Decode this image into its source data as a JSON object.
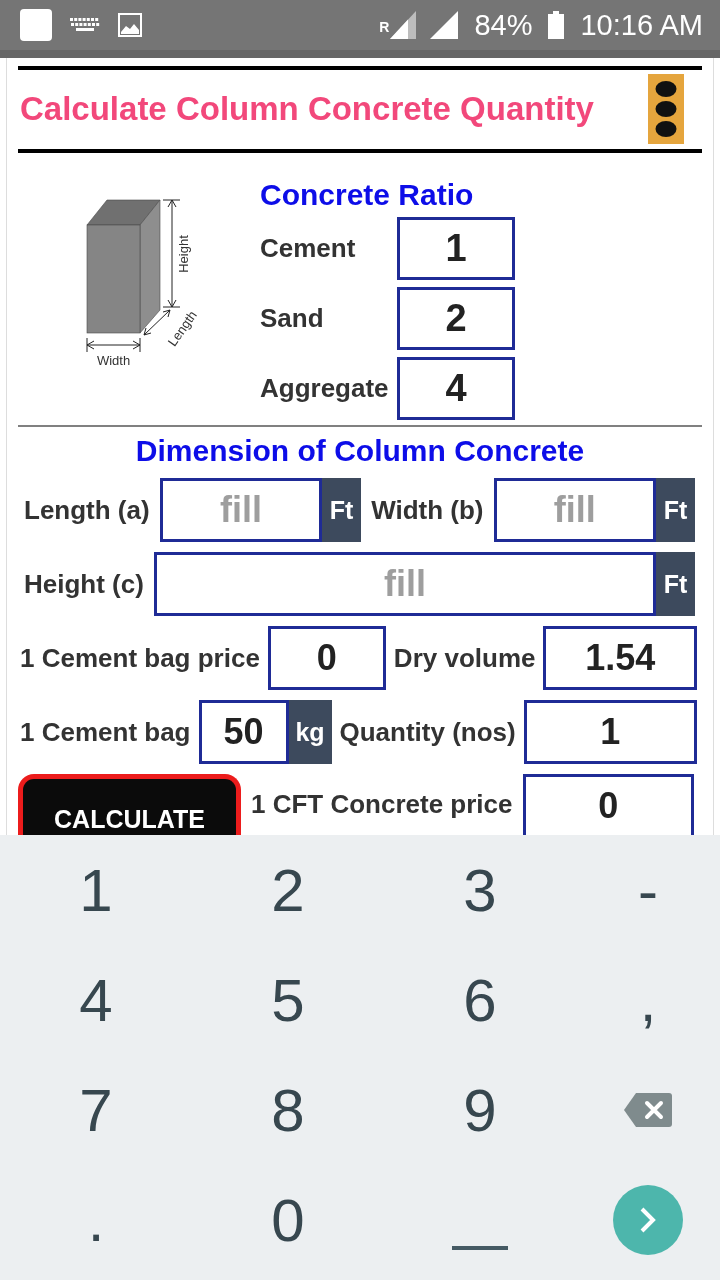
{
  "status_bar": {
    "roaming": "R",
    "battery": "84%",
    "time": "10:16 AM"
  },
  "header": {
    "title": "Calculate Column Concrete Quantity"
  },
  "figure": {
    "height_label": "Height",
    "length_label": "Length",
    "width_label": "Width"
  },
  "ratio": {
    "heading": "Concrete Ratio",
    "rows": [
      {
        "label": "Cement",
        "value": "1"
      },
      {
        "label": "Sand",
        "value": "2"
      },
      {
        "label": "Aggregate",
        "value": "4"
      }
    ]
  },
  "dimensions": {
    "heading": "Dimension of Column Concrete",
    "rows": [
      {
        "fields": [
          {
            "label": "Length (a)",
            "placeholder": "fill",
            "unit": "Ft"
          },
          {
            "label": "Width (b)",
            "placeholder": "fill",
            "unit": "Ft"
          }
        ]
      },
      {
        "fields": [
          {
            "label": "Height (c)",
            "placeholder": "fill",
            "unit": "Ft"
          }
        ]
      }
    ]
  },
  "results": {
    "rows": [
      {
        "items": [
          {
            "kind": "field",
            "label": "1 Cement bag price",
            "value": "0"
          },
          {
            "kind": "field",
            "label": "Dry volume",
            "value": "1.54"
          }
        ]
      },
      {
        "items": [
          {
            "kind": "field",
            "label": "1 Cement bag",
            "value": "50",
            "unit": "kg"
          },
          {
            "kind": "field",
            "label": "Quantity (nos)",
            "value": "1"
          }
        ]
      },
      {
        "items": [
          {
            "kind": "button",
            "label": "CALCULATE"
          },
          {
            "kind": "field",
            "label": "1 CFT Concrete price",
            "value": "0"
          }
        ]
      }
    ]
  },
  "keyboard": {
    "keys": [
      {
        "kind": "char",
        "label": "1"
      },
      {
        "kind": "char",
        "label": "2"
      },
      {
        "kind": "char",
        "label": "3"
      },
      {
        "kind": "char",
        "label": "-"
      },
      {
        "kind": "char",
        "label": "4"
      },
      {
        "kind": "char",
        "label": "5"
      },
      {
        "kind": "char",
        "label": "6"
      },
      {
        "kind": "char",
        "label": ","
      },
      {
        "kind": "char",
        "label": "7"
      },
      {
        "kind": "char",
        "label": "8"
      },
      {
        "kind": "char",
        "label": "9"
      },
      {
        "kind": "backspace"
      },
      {
        "kind": "char",
        "label": "."
      },
      {
        "kind": "char",
        "label": "0"
      },
      {
        "kind": "space"
      },
      {
        "kind": "enter"
      }
    ]
  }
}
